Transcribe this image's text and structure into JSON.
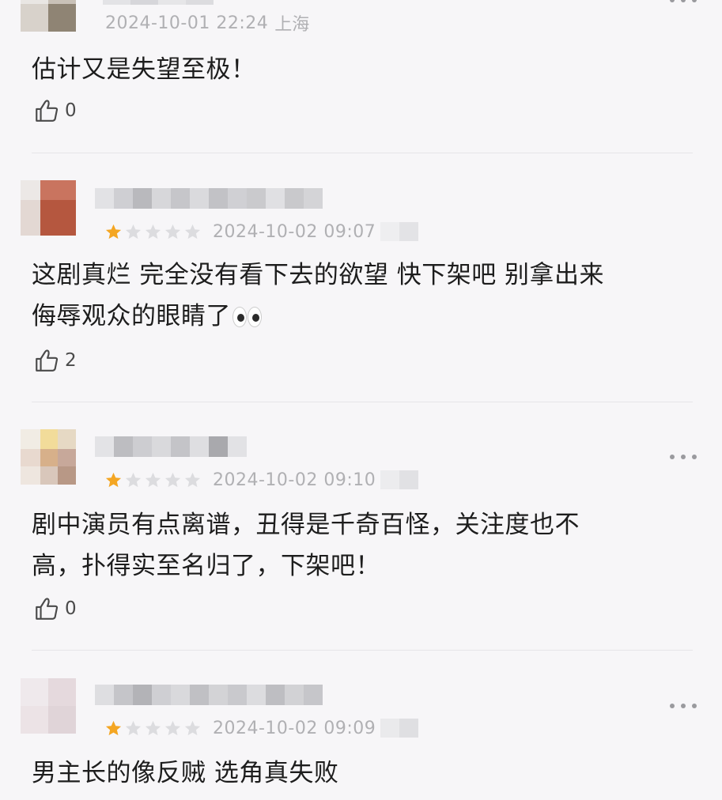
{
  "comments": [
    {
      "timestamp": "2024-10-01 22:24",
      "location": "上海",
      "text_lines": [
        "估计又是失望至极！"
      ],
      "likes": "0"
    },
    {
      "rating": 1,
      "rating_max": 5,
      "timestamp": "2024-10-02 09:07",
      "text_lines": [
        "这剧真烂 完全没有看下去的欲望  快下架吧  别拿出来",
        "侮辱观众的眼睛了"
      ],
      "emoji": "eyes",
      "likes": "2"
    },
    {
      "rating": 1,
      "rating_max": 5,
      "timestamp": "2024-10-02 09:10",
      "text_lines": [
        "剧中演员有点离谱，丑得是千奇百怪，关注度也不",
        "高，扑得实至名归了，下架吧！"
      ],
      "likes": "0"
    },
    {
      "rating": 1,
      "rating_max": 5,
      "timestamp": "2024-10-02 09:09",
      "text_lines": [
        "男主长的像反贼  选角真失败"
      ]
    }
  ],
  "colors": {
    "star_filled": "#f4a623",
    "star_empty": "#dcdcdf",
    "meta_text": "#b0b0b3",
    "divider": "#e6e5e8"
  },
  "icons": {
    "like": "thumbs-up-icon",
    "more": "more-dots-icon",
    "star": "star-icon"
  }
}
